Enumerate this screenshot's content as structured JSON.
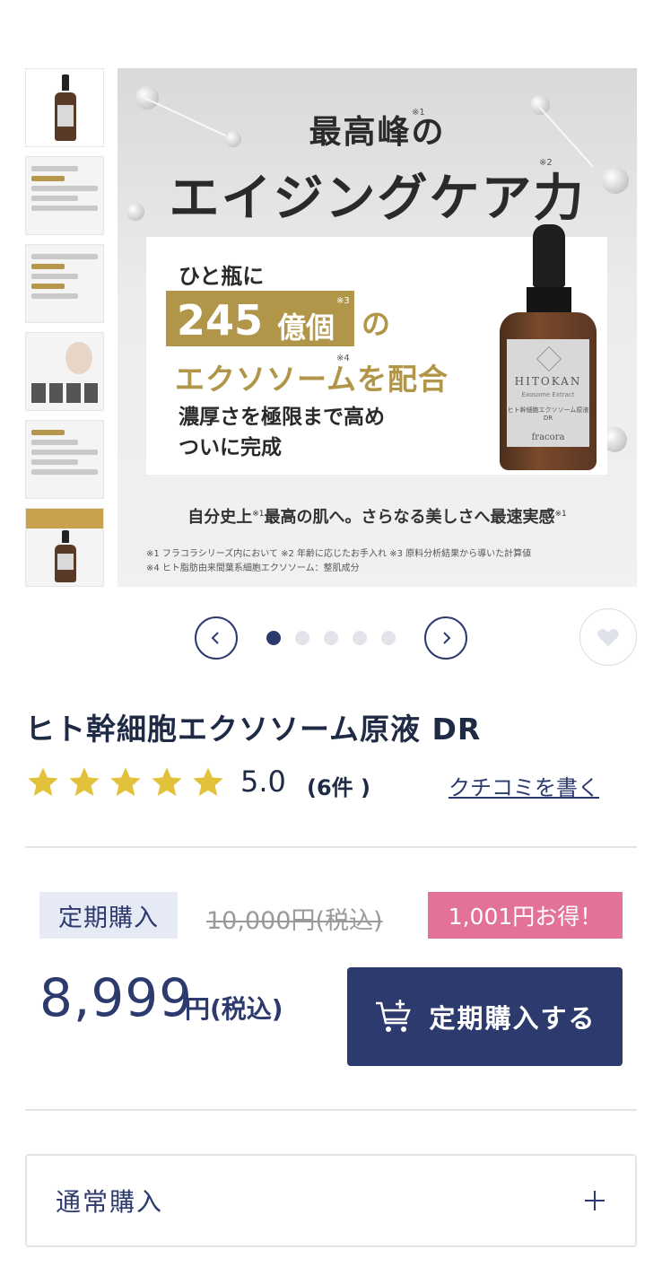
{
  "gallery": {
    "hero": {
      "title_line1": "最高峰のエイジングケア力",
      "title_part1": "最高峰の",
      "title_part2": "エイジングケア力",
      "note_mark1": "※1",
      "note_mark2": "※2",
      "note_mark3": "※3",
      "note_mark4": "※4",
      "panel_line1": "ひと瓶に",
      "panel_number": "245",
      "panel_unit": "億個",
      "panel_particle": "の",
      "panel_line3": "エクソソームを配合",
      "panel_line4": "濃厚さを極限まで高め",
      "panel_line5": "ついに完成",
      "tagline": "自分史上※1最高の肌へ。さらなる美しさへ最速実感※1",
      "tagline_a": "自分史上",
      "tagline_b": "最高の肌へ。さらなる美しさへ最速実感",
      "footnote1": "※1 フラコラシリーズ内において ※2 年齢に応じたお手入れ ※3 原料分析結果から導いた計算値",
      "footnote2": "※4 ヒト脂肪由来間葉系細胞エクソソーム：整肌成分",
      "bottle_brand": "HITOKAN",
      "bottle_sub": "Exosome Extract",
      "bottle_name": "ヒト幹細胞エクソソーム原液DR",
      "bottle_maker": "fracora"
    },
    "thumbnails": [
      {
        "name": "thumb-bottle"
      },
      {
        "name": "thumb-aging-care",
        "text": "最高峰のエイジングケア力"
      },
      {
        "name": "thumb-features",
        "text": "ここがすごい"
      },
      {
        "name": "thumb-model"
      },
      {
        "name": "thumb-steps"
      },
      {
        "name": "thumb-detail"
      }
    ],
    "active_index": 0,
    "dots_total": 5
  },
  "product": {
    "title": "ヒト幹細胞エクソソーム原液 DR",
    "rating_value": "5.0",
    "rating_stars": 5,
    "review_count": "(6件 )",
    "write_review": "クチコミを書く"
  },
  "pricing": {
    "subscription_label": "定期購入",
    "original_price": "10,000円(税込)",
    "savings": "1,001円お得！",
    "price": "8,999",
    "price_unit": "円(税込)",
    "buy_button": "定期購入する"
  },
  "normal_purchase": {
    "label": "通常購入",
    "expand_icon": "plus-icon"
  },
  "colors": {
    "navy": "#2c3a6e",
    "gold": "#b19548",
    "star": "#e2c23a",
    "pink": "#e27396",
    "badge_bg": "#e5eaf4"
  }
}
